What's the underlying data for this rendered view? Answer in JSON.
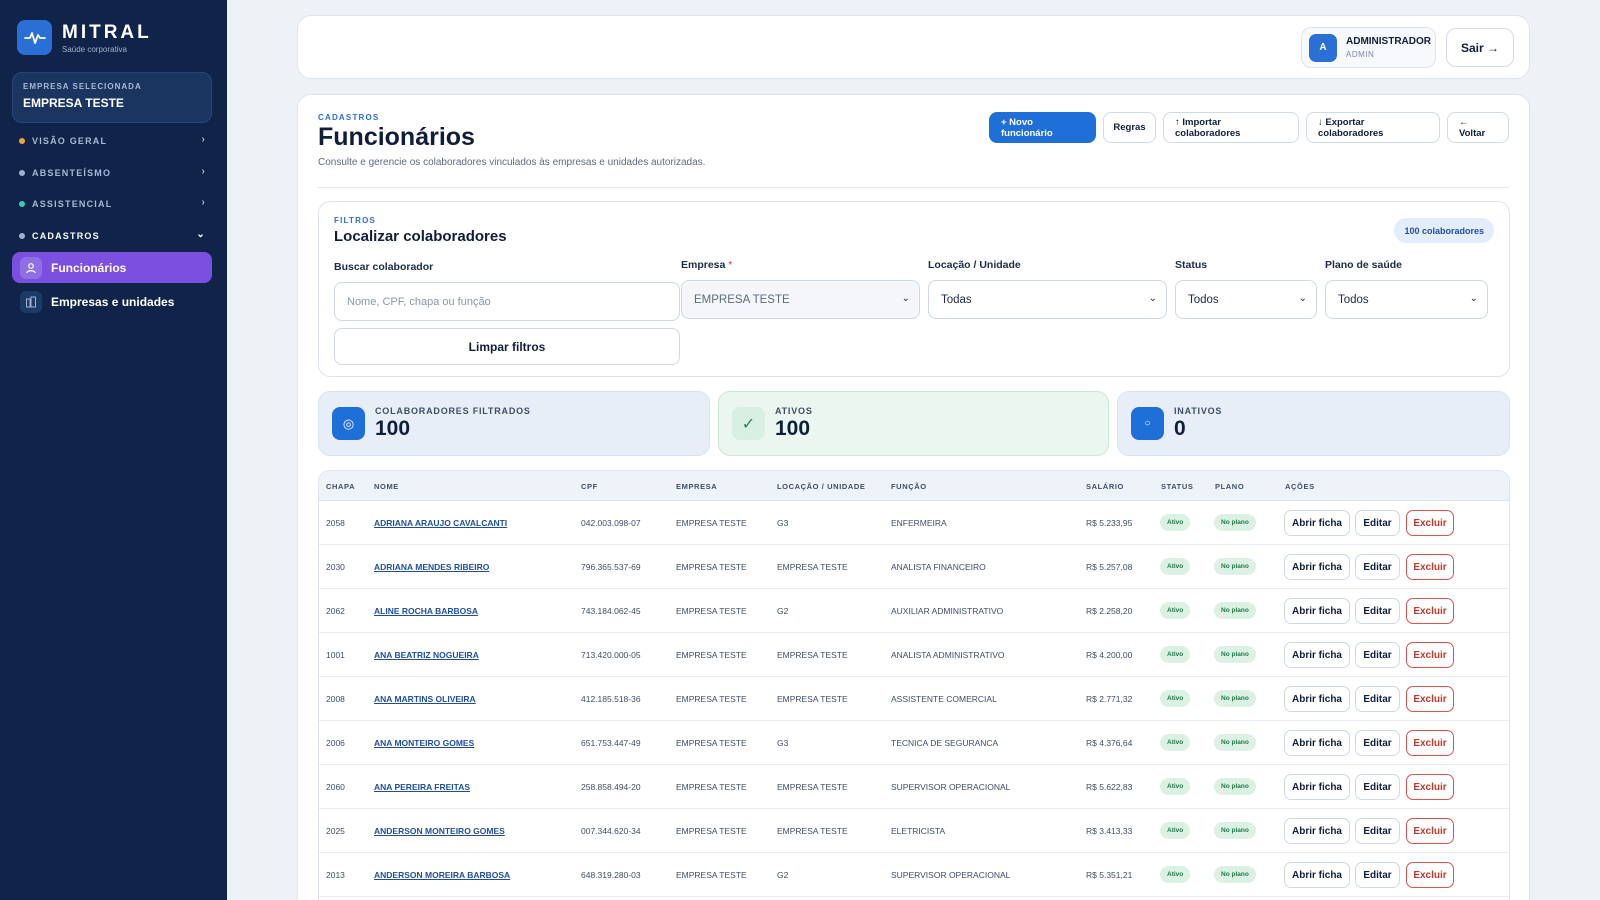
{
  "brand": {
    "name": "MITRAL",
    "tagline": "Saúde corporativa"
  },
  "sidebar": {
    "company_label": "EMPRESA SELECIONADA",
    "company_value": "EMPRESA TESTE",
    "sections": [
      {
        "label": "VISÃO GERAL",
        "color": "#f0a23b"
      },
      {
        "label": "ABSENTEÍSMO",
        "color": "#9fb3d1"
      },
      {
        "label": "ASSISTENCIAL",
        "color": "#3fc8b6"
      },
      {
        "label": "CADASTROS",
        "color": "#9fb3d1"
      }
    ],
    "items": [
      {
        "label": "Funcionários"
      },
      {
        "label": "Empresas e unidades"
      }
    ]
  },
  "topbar": {
    "user_initial": "A",
    "user_name": "ADMINISTRADOR",
    "user_role": "ADMIN",
    "logout_label": "Sair →"
  },
  "page": {
    "eyebrow": "CADASTROS",
    "title": "Funcionários",
    "description": "Consulte e gerencie os colaboradores vinculados às empresas e unidades autorizadas.",
    "actions": {
      "new": "+ Novo funcionário",
      "rules": "Regras",
      "import": "↑ Importar colaboradores",
      "export": "↓ Exportar colaboradores",
      "back": "← Voltar"
    }
  },
  "filters": {
    "eyebrow": "FILTROS",
    "title": "Localizar colaboradores",
    "count_badge": "100 colaboradores",
    "search_label": "Buscar colaborador",
    "search_placeholder": "Nome, CPF, chapa ou função",
    "company_label": "Empresa",
    "company_required": "*",
    "company_value": "EMPRESA TESTE",
    "location_label": "Locação / Unidade",
    "location_value": "Todas",
    "status_label": "Status",
    "status_value": "Todos",
    "plan_label": "Plano de saúde",
    "plan_value": "Todos",
    "clear_label": "Limpar filtros"
  },
  "stats": [
    {
      "label": "COLABORADORES FILTRADOS",
      "value": "100"
    },
    {
      "label": "ATIVOS",
      "value": "100"
    },
    {
      "label": "INATIVOS",
      "value": "0"
    }
  ],
  "table": {
    "headers": [
      "CHAPA",
      "NOME",
      "CPF",
      "EMPRESA",
      "LOCAÇÃO / UNIDADE",
      "FUNÇÃO",
      "SALÁRIO",
      "STATUS",
      "PLANO",
      "AÇÕES"
    ],
    "row_actions": {
      "open": "Abrir ficha",
      "edit": "Editar",
      "delete": "Excluir"
    },
    "rows": [
      [
        "2058",
        "ADRIANA ARAUJO CAVALCANTI",
        "042.003.098-07",
        "EMPRESA TESTE",
        "G3",
        "ENFERMEIRA",
        "R$ 5.233,95",
        "Ativo",
        "No plano"
      ],
      [
        "2030",
        "ADRIANA MENDES RIBEIRO",
        "796.365.537-69",
        "EMPRESA TESTE",
        "EMPRESA TESTE",
        "ANALISTA FINANCEIRO",
        "R$ 5.257,08",
        "Ativo",
        "No plano"
      ],
      [
        "2062",
        "ALINE ROCHA BARBOSA",
        "743.184.062-45",
        "EMPRESA TESTE",
        "G2",
        "AUXILIAR ADMINISTRATIVO",
        "R$ 2.258,20",
        "Ativo",
        "No plano"
      ],
      [
        "1001",
        "ANA BEATRIZ NOGUEIRA",
        "713.420.000-05",
        "EMPRESA TESTE",
        "EMPRESA TESTE",
        "ANALISTA ADMINISTRATIVO",
        "R$ 4.200,00",
        "Ativo",
        "No plano"
      ],
      [
        "2008",
        "ANA MARTINS OLIVEIRA",
        "412.185.518-36",
        "EMPRESA TESTE",
        "EMPRESA TESTE",
        "ASSISTENTE COMERCIAL",
        "R$ 2.771,32",
        "Ativo",
        "No plano"
      ],
      [
        "2006",
        "ANA MONTEIRO GOMES",
        "651.753.447-49",
        "EMPRESA TESTE",
        "G3",
        "TECNICA DE SEGURANCA",
        "R$ 4.376,64",
        "Ativo",
        "No plano"
      ],
      [
        "2060",
        "ANA PEREIRA FREITAS",
        "258.858.494-20",
        "EMPRESA TESTE",
        "EMPRESA TESTE",
        "SUPERVISOR OPERACIONAL",
        "R$ 5.622,83",
        "Ativo",
        "No plano"
      ],
      [
        "2025",
        "ANDERSON MONTEIRO GOMES",
        "007.344.620-34",
        "EMPRESA TESTE",
        "EMPRESA TESTE",
        "ELETRICISTA",
        "R$ 3.413,33",
        "Ativo",
        "No plano"
      ],
      [
        "2013",
        "ANDERSON MOREIRA BARBOSA",
        "648.319.280-03",
        "EMPRESA TESTE",
        "G2",
        "SUPERVISOR OPERACIONAL",
        "R$ 5.351,21",
        "Ativo",
        "No plano"
      ]
    ]
  }
}
